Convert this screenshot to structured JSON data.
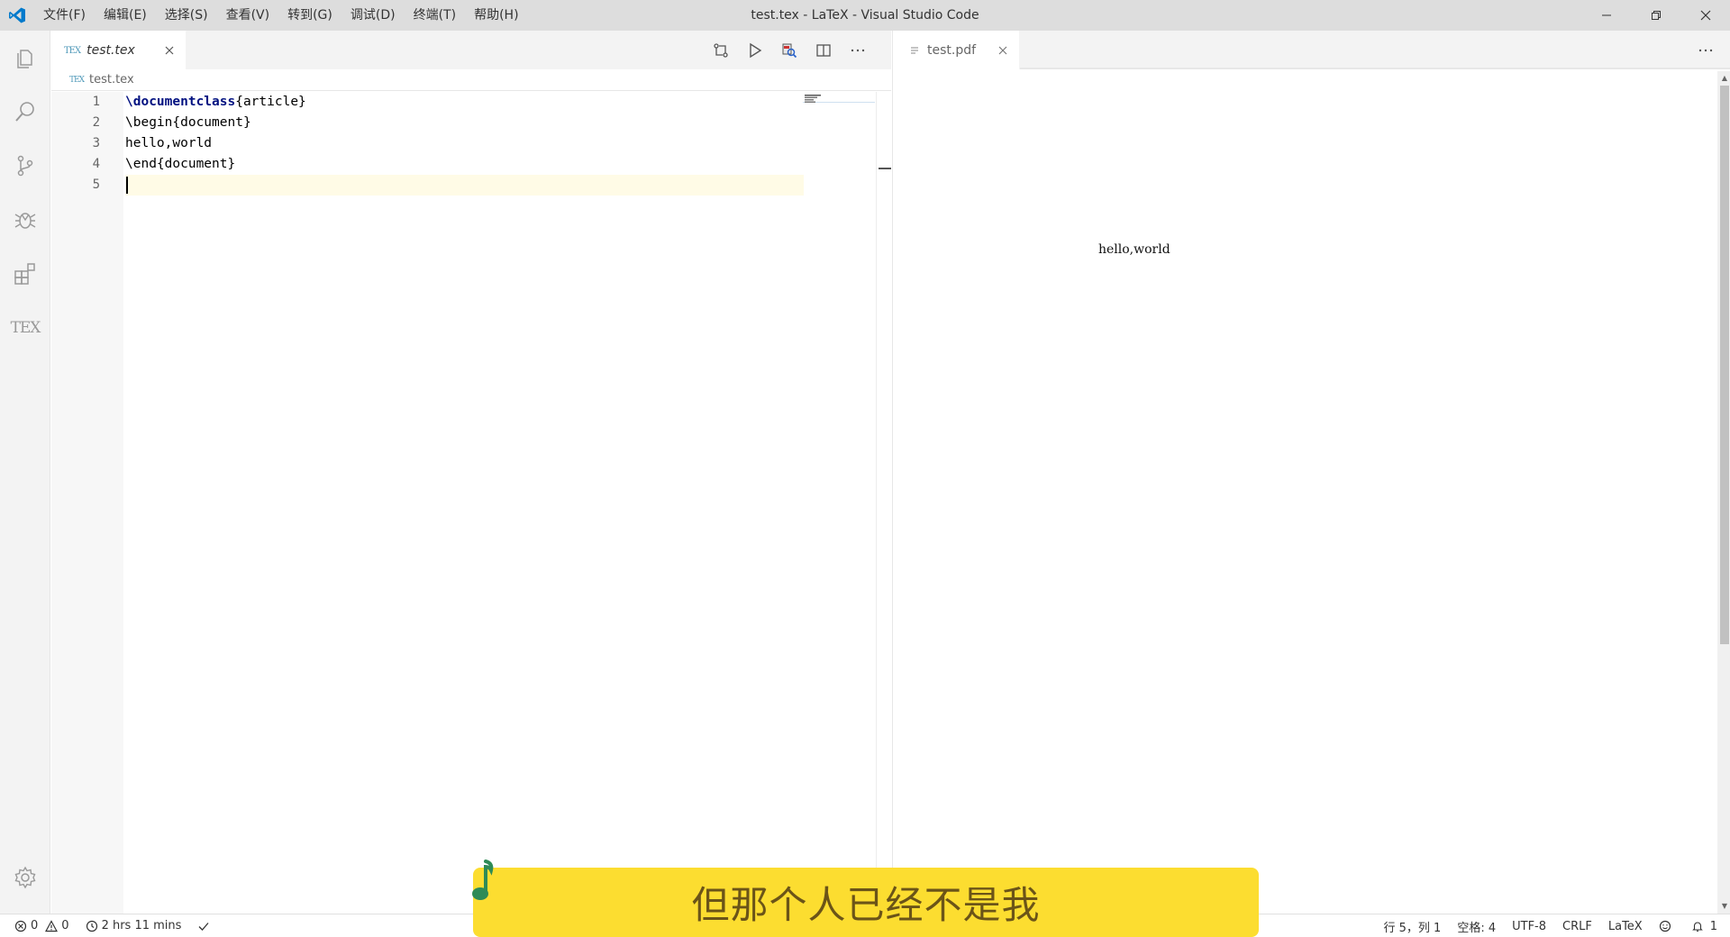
{
  "window": {
    "title": "test.tex - LaTeX - Visual Studio Code"
  },
  "menu": [
    "文件(F)",
    "编辑(E)",
    "选择(S)",
    "查看(V)",
    "转到(G)",
    "调试(D)",
    "终端(T)",
    "帮助(H)"
  ],
  "activity_bar": {
    "tex_label": "TEX"
  },
  "left_editor": {
    "tab": {
      "icon_text": "TEX",
      "label": "test.tex"
    },
    "breadcrumb": {
      "icon_text": "TEX",
      "label": "test.tex"
    },
    "lines": [
      {
        "num": "1",
        "kw": "\\documentclass",
        "rest": "{article}"
      },
      {
        "num": "2",
        "kw": "",
        "rest": "\\begin{document}"
      },
      {
        "num": "3",
        "kw": "",
        "rest": "hello,world"
      },
      {
        "num": "4",
        "kw": "",
        "rest": "\\end{document}"
      },
      {
        "num": "5",
        "kw": "",
        "rest": ""
      }
    ]
  },
  "right_editor": {
    "tab": {
      "label": "test.pdf"
    },
    "pdf_text": "hello,world"
  },
  "status_bar": {
    "errors": "0",
    "warnings": "0",
    "time": "2 hrs 11 mins",
    "position": "行 5，列 1",
    "spaces": "空格: 4",
    "encoding": "UTF-8",
    "eol": "CRLF",
    "language": "LaTeX",
    "notifications": "1"
  },
  "lyric": {
    "text": "但那个人已经不是我"
  },
  "colors": {
    "accent": "#007acc",
    "lyric_bg": "#fcdd30",
    "keyword": "#001080"
  }
}
